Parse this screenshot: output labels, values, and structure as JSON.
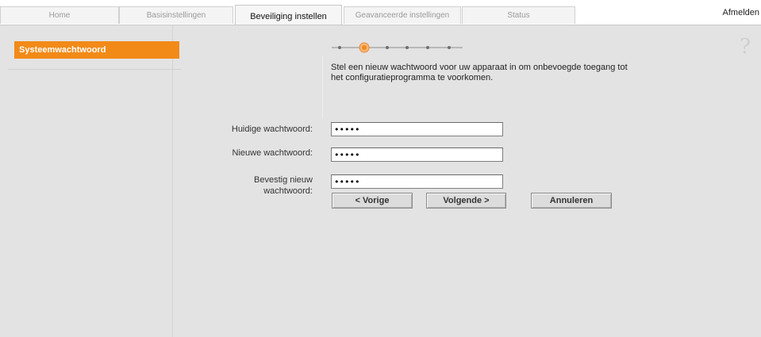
{
  "tabs": [
    {
      "label": "Home"
    },
    {
      "label": "Basisinstellingen"
    },
    {
      "label": "Beveiliging instellen"
    },
    {
      "label": "Geavanceerde instellingen"
    },
    {
      "label": "Status"
    }
  ],
  "logout_label": "Afmelden",
  "sidebar": {
    "items": [
      {
        "label": "Systeemwachtwoord"
      }
    ]
  },
  "help_icon": "?",
  "wizard": {
    "current_step": 2,
    "total_steps": 6
  },
  "form": {
    "intro": "Stel een nieuw wachtwoord voor uw apparaat in om onbevoegde toegang tot het configuratieprogramma te voorkomen.",
    "fields": [
      {
        "label": "Huidige wachtwoord:",
        "value": "•••••"
      },
      {
        "label": "Nieuwe wachtwoord:",
        "value": "•••••"
      },
      {
        "label": "Bevestig nieuw wachtwoord:",
        "value": "•••••"
      }
    ]
  },
  "buttons": {
    "prev": "< Vorige",
    "next": "Volgende >",
    "cancel": "Annuleren"
  },
  "colors": {
    "accent": "#f28a18",
    "background": "#e3e3e3"
  }
}
